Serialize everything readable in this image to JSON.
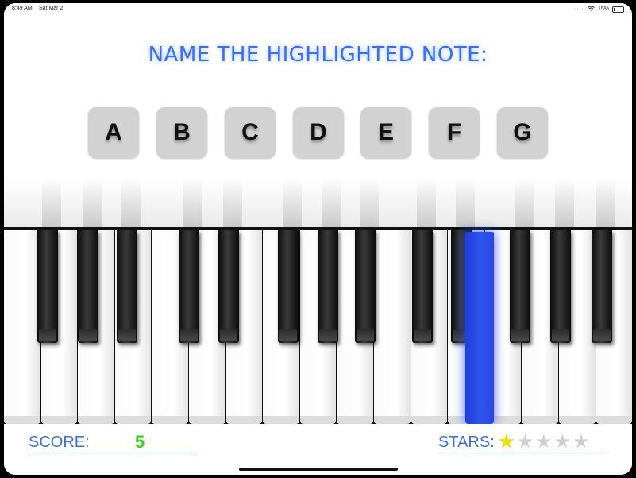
{
  "status_bar": {
    "time": "8:49 AM",
    "date": "Sat Mar 2",
    "battery": "15%"
  },
  "title": "NAME THE HIGHLIGHTED NOTE:",
  "answers": [
    "A",
    "B",
    "C",
    "D",
    "E",
    "F",
    "G"
  ],
  "piano": {
    "highlighted_key": "black key (right of center)",
    "highlight_color": "#2f55f0"
  },
  "score": {
    "label": "SCORE:",
    "value": "5"
  },
  "stars": {
    "label": "STARS:",
    "earned": 1,
    "total": 5,
    "earned_color": "#f1df14",
    "empty_color": "#cfcfcf"
  },
  "colors": {
    "accent": "#3b6df2",
    "score_value": "#35d11f",
    "button_bg": "#d2d2d2"
  }
}
